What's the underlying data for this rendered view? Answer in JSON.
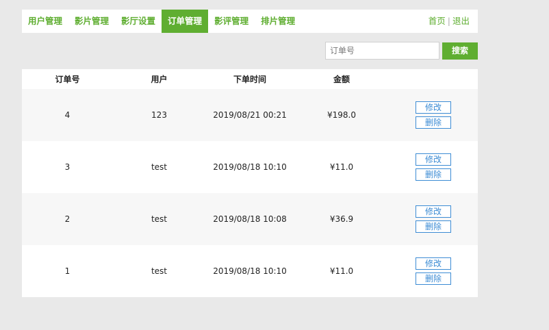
{
  "nav": {
    "items": [
      {
        "label": "用户管理",
        "active": false
      },
      {
        "label": "影片管理",
        "active": false
      },
      {
        "label": "影厅设置",
        "active": false
      },
      {
        "label": "订单管理",
        "active": true
      },
      {
        "label": "影评管理",
        "active": false
      },
      {
        "label": "排片管理",
        "active": false
      }
    ],
    "home": "首页",
    "separator": "|",
    "logout": "退出"
  },
  "search": {
    "placeholder": "订单号",
    "value": "",
    "button": "搜索"
  },
  "table": {
    "headers": [
      "订单号",
      "用户",
      "下单时间",
      "金额"
    ],
    "rows": [
      {
        "id": "4",
        "user": "123",
        "time": "2019/08/21 00:21",
        "amount": "¥198.0",
        "edit": "修改",
        "delete": "删除"
      },
      {
        "id": "3",
        "user": "test",
        "time": "2019/08/18 10:10",
        "amount": "¥11.0",
        "edit": "修改",
        "delete": "删除"
      },
      {
        "id": "2",
        "user": "test",
        "time": "2019/08/18 10:08",
        "amount": "¥36.9",
        "edit": "修改",
        "delete": "删除"
      },
      {
        "id": "1",
        "user": "test",
        "time": "2019/08/18 10:10",
        "amount": "¥11.0",
        "edit": "修改",
        "delete": "删除"
      }
    ]
  },
  "colors": {
    "accent": "#5fae31",
    "action": "#3b8bd4",
    "background": "#e9e9e9"
  }
}
